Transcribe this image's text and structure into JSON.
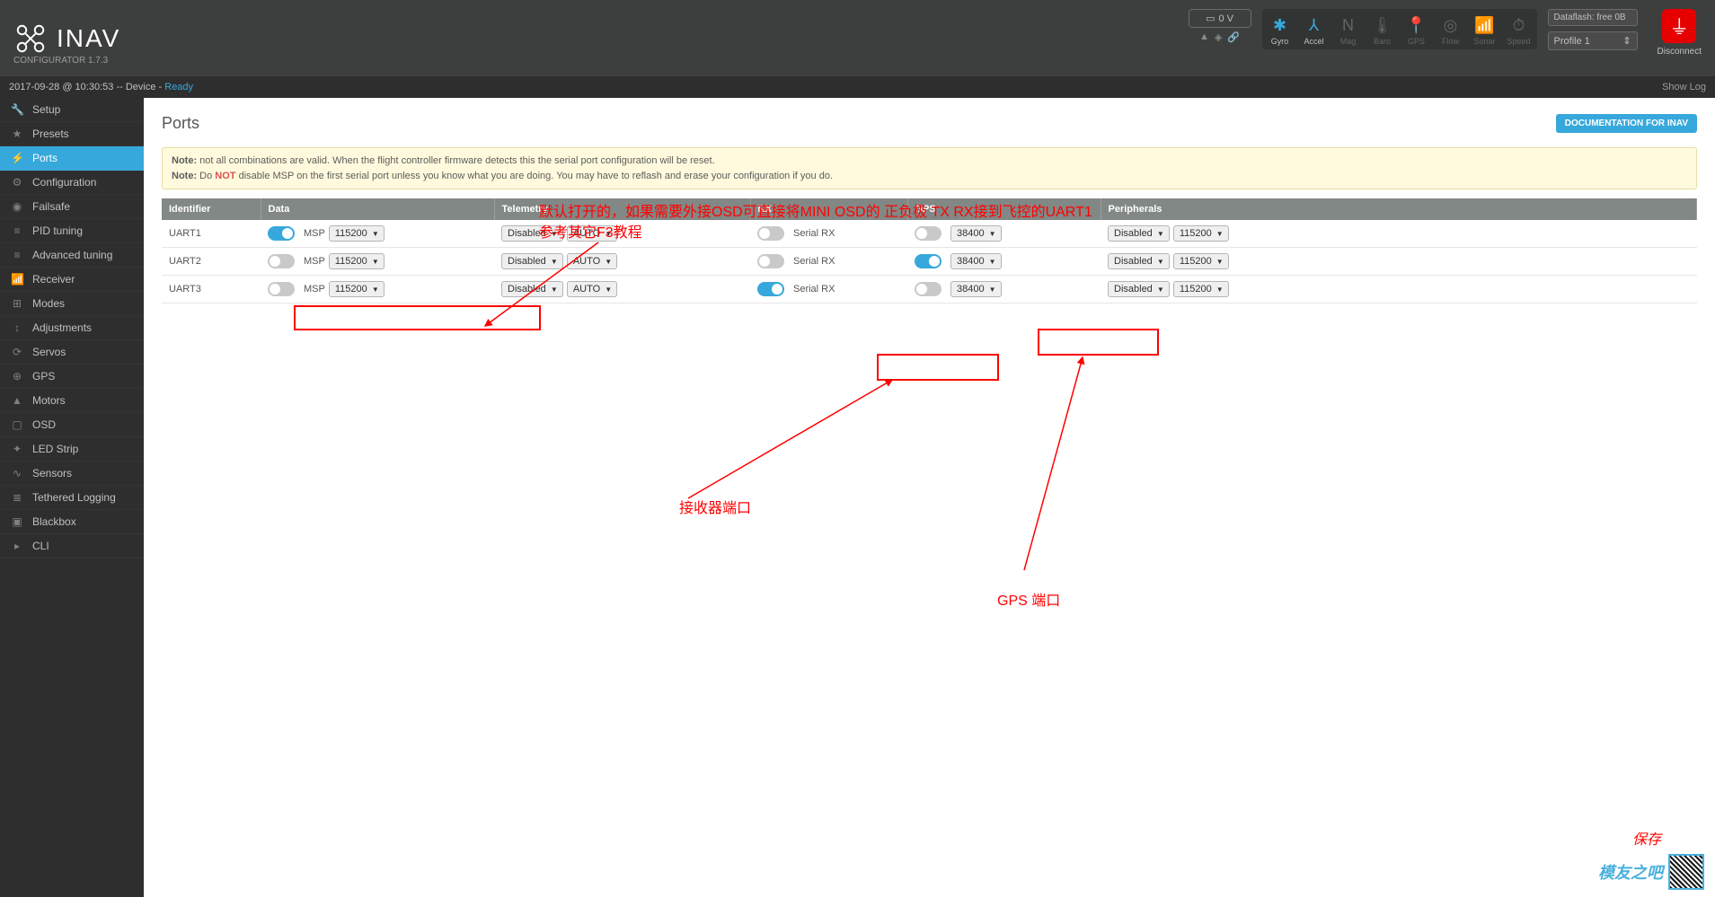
{
  "app": {
    "name": "INAV",
    "configurator": "CONFIGURATOR  1.7.3"
  },
  "header": {
    "voltage": "0 V",
    "dataflash": "Dataflash: free 0B",
    "profile": "Profile 1",
    "disconnect": "Disconnect",
    "sensors": [
      {
        "label": "Gyro",
        "active": true
      },
      {
        "label": "Accel",
        "active": true
      },
      {
        "label": "Mag",
        "active": false
      },
      {
        "label": "Baro",
        "active": false
      },
      {
        "label": "GPS",
        "active": false
      },
      {
        "label": "Flow",
        "active": false
      },
      {
        "label": "Sonar",
        "active": false
      },
      {
        "label": "Speed",
        "active": false
      }
    ]
  },
  "statusbar": {
    "timestamp": "2017-09-28 @ 10:30:53",
    "device": "Device",
    "ready": "Ready",
    "showlog": "Show Log"
  },
  "sidebar": {
    "items": [
      {
        "label": "Setup",
        "icon": "wrench"
      },
      {
        "label": "Presets",
        "icon": "star"
      },
      {
        "label": "Ports",
        "icon": "plug",
        "active": true
      },
      {
        "label": "Configuration",
        "icon": "gear"
      },
      {
        "label": "Failsafe",
        "icon": "life-ring"
      },
      {
        "label": "PID tuning",
        "icon": "sliders"
      },
      {
        "label": "Advanced tuning",
        "icon": "sliders"
      },
      {
        "label": "Receiver",
        "icon": "signal"
      },
      {
        "label": "Modes",
        "icon": "toggles"
      },
      {
        "label": "Adjustments",
        "icon": "adjust"
      },
      {
        "label": "Servos",
        "icon": "servo"
      },
      {
        "label": "GPS",
        "icon": "globe"
      },
      {
        "label": "Motors",
        "icon": "motor"
      },
      {
        "label": "OSD",
        "icon": "tv"
      },
      {
        "label": "LED Strip",
        "icon": "led"
      },
      {
        "label": "Sensors",
        "icon": "chart"
      },
      {
        "label": "Tethered Logging",
        "icon": "log"
      },
      {
        "label": "Blackbox",
        "icon": "box"
      },
      {
        "label": "CLI",
        "icon": "terminal"
      }
    ]
  },
  "page": {
    "title": "Ports",
    "doc_btn": "DOCUMENTATION FOR INAV",
    "note1_label": "Note:",
    "note1": " not all combinations are valid. When the flight controller firmware detects this the serial port configuration will be reset.",
    "note2_label": "Note:",
    "note2_pre": " Do ",
    "note2_not": "NOT",
    "note2_post": " disable MSP on the first serial port unless you know what you are doing. You may have to reflash and erase your configuration if you do."
  },
  "table": {
    "headers": {
      "id": "Identifier",
      "data": "Data",
      "tel": "Telemetry",
      "rx": "RX",
      "gps": "GPS",
      "per": "Peripherals"
    },
    "msp": "MSP",
    "serialrx": "Serial RX",
    "disabled": "Disabled",
    "auto": "AUTO",
    "rows": [
      {
        "id": "UART1",
        "msp_on": true,
        "msp_baud": "115200",
        "tel": "Disabled",
        "tel_baud": "AUTO",
        "rx_on": false,
        "gps_on": false,
        "gps_baud": "38400",
        "per": "Disabled",
        "per_baud": "115200"
      },
      {
        "id": "UART2",
        "msp_on": false,
        "msp_baud": "115200",
        "tel": "Disabled",
        "tel_baud": "AUTO",
        "rx_on": false,
        "gps_on": true,
        "gps_baud": "38400",
        "per": "Disabled",
        "per_baud": "115200"
      },
      {
        "id": "UART3",
        "msp_on": false,
        "msp_baud": "115200",
        "tel": "Disabled",
        "tel_baud": "AUTO",
        "rx_on": true,
        "gps_on": false,
        "gps_baud": "38400",
        "per": "Disabled",
        "per_baud": "115200"
      }
    ]
  },
  "annotations": {
    "top1": "默认打开的，如果需要外接OSD可直接将MINI OSD的 正负极 TX RX接到飞控的UART1",
    "top2": "参考其它F3教程",
    "rx_label": "接收器端口",
    "gps_label": "GPS 端口",
    "save": "保存"
  },
  "watermark": "模友之吧"
}
